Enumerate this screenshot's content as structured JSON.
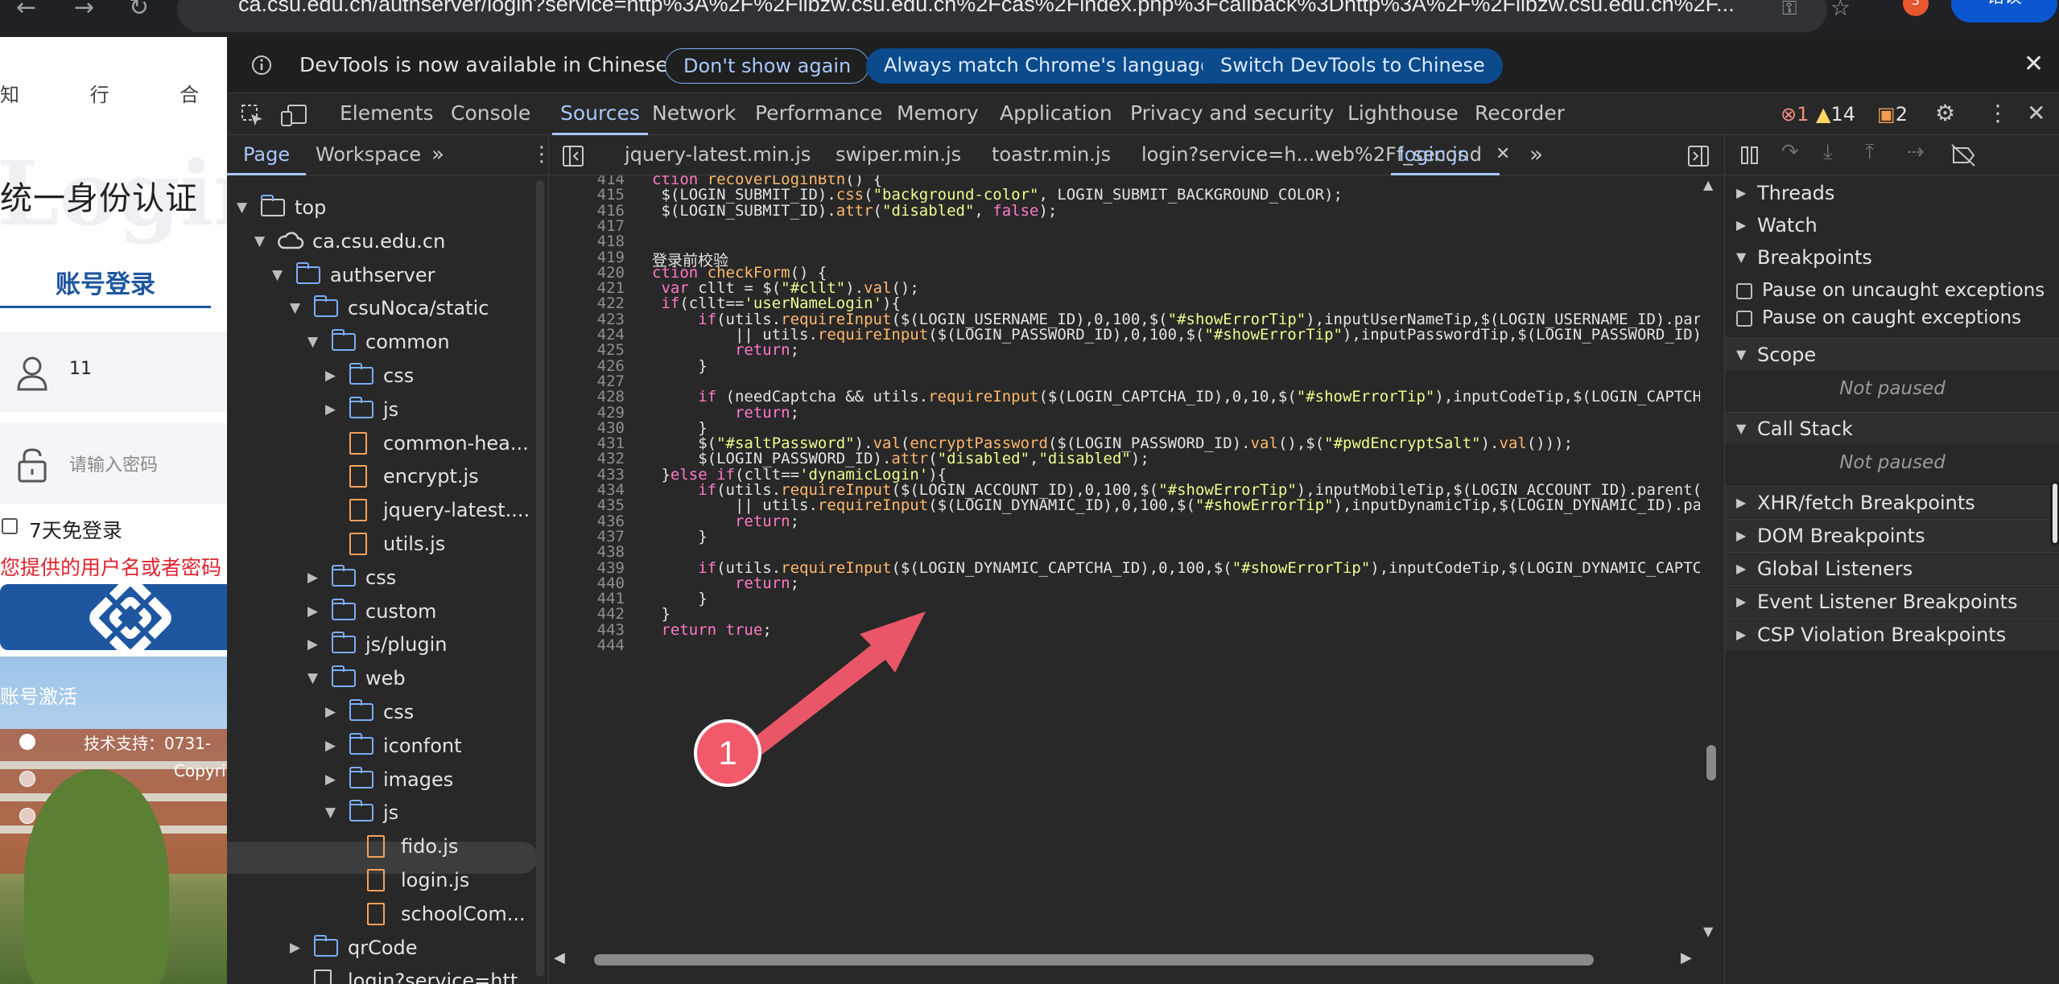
{
  "browser": {
    "url": "ca.csu.edu.cn/authserver/login?service=http%3A%2F%2Flibzw.csu.edu.cn%2Fcas%2Findex.php%3Fcallback%3Dhttp%3A%2F%2Flibzw.csu.edu.cn%2F...",
    "extension_badge": "3",
    "error_button": "错误"
  },
  "login_page": {
    "motto": "知 行 合 一",
    "title": "统一身份认证",
    "tab_label": "账号登录",
    "username_value": "11",
    "password_placeholder": "请输入密码",
    "remember_label": "7天免登录",
    "error_text": "您提供的用户名或者密码",
    "activate_link": "账号激活",
    "support_text": "技术支持：0731-",
    "copyright_text": "Copyri"
  },
  "devtools": {
    "infobar": {
      "message": "DevTools is now available in Chinese",
      "btn_dont_show": "Don't show again",
      "btn_match": "Always match Chrome's language",
      "btn_switch": "Switch DevTools to Chinese"
    },
    "main_tabs": [
      "Elements",
      "Console",
      "Sources",
      "Network",
      "Performance",
      "Memory",
      "Application",
      "Privacy and security",
      "Lighthouse",
      "Recorder"
    ],
    "selected_tab": "Sources",
    "counts": {
      "errors": "1",
      "warnings": "14",
      "issues": "2"
    },
    "navigator": {
      "tabs": [
        "Page",
        "Workspace"
      ],
      "tree": [
        {
          "label": "top",
          "depth": 0,
          "kind": "frame",
          "open": true
        },
        {
          "label": "ca.csu.edu.cn",
          "depth": 1,
          "kind": "cloud",
          "open": true
        },
        {
          "label": "authserver",
          "depth": 2,
          "kind": "folder",
          "open": true
        },
        {
          "label": "csuNoca/static",
          "depth": 3,
          "kind": "folder",
          "open": true
        },
        {
          "label": "common",
          "depth": 4,
          "kind": "folder",
          "open": true
        },
        {
          "label": "css",
          "depth": 5,
          "kind": "folder",
          "open": false
        },
        {
          "label": "js",
          "depth": 5,
          "kind": "folder",
          "open": false
        },
        {
          "label": "common-hea...",
          "depth": 5,
          "kind": "file"
        },
        {
          "label": "encrypt.js",
          "depth": 5,
          "kind": "file"
        },
        {
          "label": "jquery-latest....",
          "depth": 5,
          "kind": "file"
        },
        {
          "label": "utils.js",
          "depth": 5,
          "kind": "file"
        },
        {
          "label": "css",
          "depth": 4,
          "kind": "folder",
          "open": false
        },
        {
          "label": "custom",
          "depth": 4,
          "kind": "folder",
          "open": false
        },
        {
          "label": "js/plugin",
          "depth": 4,
          "kind": "folder",
          "open": false
        },
        {
          "label": "web",
          "depth": 4,
          "kind": "folder",
          "open": true
        },
        {
          "label": "css",
          "depth": 5,
          "kind": "folder",
          "open": false
        },
        {
          "label": "iconfont",
          "depth": 5,
          "kind": "folder",
          "open": false
        },
        {
          "label": "images",
          "depth": 5,
          "kind": "folder",
          "open": false
        },
        {
          "label": "js",
          "depth": 5,
          "kind": "folder",
          "open": true
        },
        {
          "label": "fido.js",
          "depth": 6,
          "kind": "file"
        },
        {
          "label": "login.js",
          "depth": 6,
          "kind": "file",
          "selected": true
        },
        {
          "label": "schoolCom...",
          "depth": 6,
          "kind": "file"
        },
        {
          "label": "qrCode",
          "depth": 3,
          "kind": "folder",
          "open": false
        },
        {
          "label": "login?service=htt...",
          "depth": 3,
          "kind": "doc"
        }
      ]
    },
    "editor_tabs": [
      "jquery-latest.min.js",
      "swiper.min.js",
      "toastr.min.js",
      "login?service=h...web%2Ff_second",
      "login.js"
    ],
    "selected_editor_tab": "login.js",
    "code": [
      {
        "n": "414",
        "t": "ction recoverLoginBtn() {"
      },
      {
        "n": "415",
        "t": " $(LOGIN_SUBMIT_ID).css(\"background-color\", LOGIN_SUBMIT_BACKGROUND_COLOR);"
      },
      {
        "n": "416",
        "t": " $(LOGIN_SUBMIT_ID).attr(\"disabled\", false);"
      },
      {
        "n": "417",
        "t": ""
      },
      {
        "n": "418",
        "t": ""
      },
      {
        "n": "419",
        "t": "登录前校验"
      },
      {
        "n": "420",
        "t": "ction checkForm() {"
      },
      {
        "n": "421",
        "t": " var cllt = $(\"#cllt\").val();"
      },
      {
        "n": "422",
        "t": " if(cllt=='userNameLogin'){"
      },
      {
        "n": "423",
        "t": "     if(utils.requireInput($(LOGIN_USERNAME_ID),0,100,$(\"#showErrorTip\"),inputUserNameTip,$(LOGIN_USERNAME_ID).paren"
      },
      {
        "n": "424",
        "t": "         || utils.requireInput($(LOGIN_PASSWORD_ID),0,100,$(\"#showErrorTip\"),inputPasswordTip,$(LOGIN_PASSWORD_ID).p"
      },
      {
        "n": "425",
        "t": "         return;"
      },
      {
        "n": "426",
        "t": "     }"
      },
      {
        "n": "427",
        "t": ""
      },
      {
        "n": "428",
        "t": "     if (needCaptcha && utils.requireInput($(LOGIN_CAPTCHA_ID),0,10,$(\"#showErrorTip\"),inputCodeTip,$(LOGIN_CAPTCHA_"
      },
      {
        "n": "429",
        "t": "         return;"
      },
      {
        "n": "430",
        "t": "     }"
      },
      {
        "n": "431",
        "t": "     $(\"#saltPassword\").val(encryptPassword($(LOGIN_PASSWORD_ID).val(),$(\"#pwdEncryptSalt\").val()));"
      },
      {
        "n": "432",
        "t": "     $(LOGIN_PASSWORD_ID).attr(\"disabled\",\"disabled\");"
      },
      {
        "n": "433",
        "t": " }else if(cllt=='dynamicLogin'){"
      },
      {
        "n": "434",
        "t": "     if(utils.requireInput($(LOGIN_ACCOUNT_ID),0,100,$(\"#showErrorTip\"),inputMobileTip,$(LOGIN_ACCOUNT_ID).parent()"
      },
      {
        "n": "435",
        "t": "         || utils.requireInput($(LOGIN_DYNAMIC_ID),0,100,$(\"#showErrorTip\"),inputDynamicTip,$(LOGIN_DYNAMIC_ID).pare"
      },
      {
        "n": "436",
        "t": "         return;"
      },
      {
        "n": "437",
        "t": "     }"
      },
      {
        "n": "438",
        "t": ""
      },
      {
        "n": "439",
        "t": "     if(utils.requireInput($(LOGIN_DYNAMIC_CAPTCHA_ID),0,100,$(\"#showErrorTip\"),inputCodeTip,$(LOGIN_DYNAMIC_CAPTCHA"
      },
      {
        "n": "440",
        "t": "         return;"
      },
      {
        "n": "441",
        "t": "     }"
      },
      {
        "n": "442",
        "t": " }"
      },
      {
        "n": "443",
        "t": " return true;"
      },
      {
        "n": "444",
        "t": ""
      }
    ],
    "annotation_number": "1",
    "sidebar": {
      "sections": [
        "Threads",
        "Watch",
        "Breakpoints"
      ],
      "checkbox_items": [
        "Pause on uncaught exceptions",
        "Pause on caught exceptions"
      ],
      "scope": "Scope",
      "not_paused_1": "Not paused",
      "call_stack": "Call Stack",
      "not_paused_2": "Not paused",
      "more_sections": [
        "XHR/fetch Breakpoints",
        "DOM Breakpoints",
        "Global Listeners",
        "Event Listener Breakpoints",
        "CSP Violation Breakpoints"
      ]
    }
  }
}
